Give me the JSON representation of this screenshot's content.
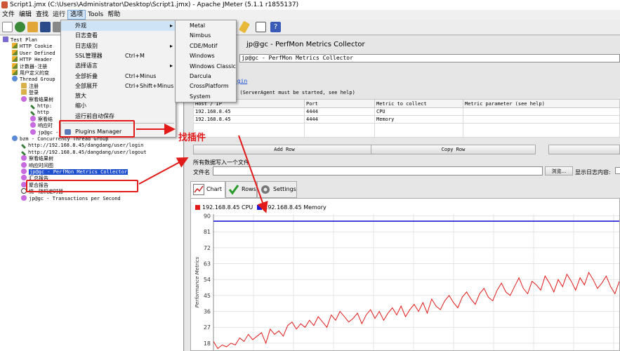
{
  "window": {
    "title": "Script1.jmx (C:\\Users\\Administrator\\Desktop\\Script1.jmx) - Apache JMeter (5.1.1 r1855137)"
  },
  "menubar": [
    "文件",
    "编辑",
    "查找",
    "运行",
    "选项",
    "Tools",
    "帮助"
  ],
  "options_menu": {
    "items": [
      {
        "label": "外观",
        "submenu": true
      },
      {
        "label": "日志查看"
      },
      {
        "label": "日志级别",
        "submenu": true
      },
      {
        "label": "SSL管理器",
        "shortcut": "Ctrl+M"
      },
      {
        "label": "选择语言",
        "submenu": true
      },
      {
        "label": "全部折叠",
        "shortcut": "Ctrl+Minus"
      },
      {
        "label": "全部展开",
        "shortcut": "Ctrl+Shift+Minus"
      },
      {
        "label": "放大"
      },
      {
        "label": "缩小"
      },
      {
        "label": "运行前自动保存"
      },
      {
        "label": "Plugins Manager"
      }
    ]
  },
  "laf_menu": [
    "Metal",
    "Nimbus",
    "CDE/Motif",
    "Windows",
    "Windows Classic",
    "Darcula",
    "CrossPlatform",
    "System"
  ],
  "annotation": {
    "text": "找插件",
    "color": "#e21a1a"
  },
  "tree": [
    {
      "label": "Test Plan",
      "icon": "test",
      "indent": 0
    },
    {
      "label": "HTTP Cookie",
      "icon": "broom",
      "indent": 1
    },
    {
      "label": "User Defined",
      "icon": "broom",
      "indent": 1
    },
    {
      "label": "HTTP Header",
      "icon": "broom",
      "indent": 1
    },
    {
      "label": "计数器-注册",
      "icon": "broom",
      "indent": 1
    },
    {
      "label": "用户定义的变",
      "icon": "broom",
      "indent": 1
    },
    {
      "label": "Thread Group",
      "icon": "thread",
      "indent": 1
    },
    {
      "label": "注册",
      "icon": "folder",
      "indent": 2
    },
    {
      "label": "登录",
      "icon": "folder",
      "indent": 2
    },
    {
      "label": "察看结果树",
      "icon": "listener",
      "indent": 2
    },
    {
      "label": "http:",
      "icon": "pen",
      "indent": 3
    },
    {
      "label": "http",
      "icon": "pen",
      "indent": 3
    },
    {
      "label": "察看结",
      "icon": "listener",
      "indent": 3
    },
    {
      "label": "响应时",
      "icon": "listener",
      "indent": 3
    },
    {
      "label": "jp@gc - PerfMon Metrics Collector",
      "icon": "listener",
      "indent": 3
    },
    {
      "label": "bzm - Concurrency Thread Group",
      "icon": "thread",
      "indent": 1
    },
    {
      "label": "http://192.168.8.45/dangdang/user/login",
      "icon": "pen",
      "indent": 2
    },
    {
      "label": "http://192.168.8.45/dangdang/user/logout",
      "icon": "pen",
      "indent": 2
    },
    {
      "label": "察看结果树",
      "icon": "listener",
      "indent": 2
    },
    {
      "label": "响应时间图",
      "icon": "listener",
      "indent": 2
    },
    {
      "label": "jp@gc - PerfMon Metrics Collector",
      "icon": "listener",
      "indent": 2,
      "selected": true
    },
    {
      "label": "汇总报告",
      "icon": "listener",
      "indent": 2
    },
    {
      "label": "聚合报告",
      "icon": "listener",
      "indent": 2
    },
    {
      "label": "统一随机定时器",
      "icon": "timer",
      "indent": 2
    },
    {
      "label": "jp@gc - Transactions per Second",
      "icon": "listener",
      "indent": 2
    }
  ],
  "panel": {
    "title": "jp@gc - PerfMon Metrics Collector",
    "name_value": "jp@gc - PerfMon Metrics Collector",
    "link": "jmeter-plugins.org/wiki/PerfMon/?utm_source=jmeter&utm_medium=helplink&utm_campaign=PerfMon",
    "link_visible": "ugin",
    "servers_label": "r (ServerAgent must be started, see help)",
    "table": {
      "headers": [
        "Host / IP",
        "Port",
        "Metric to collect",
        "Metric parameter (see help)"
      ],
      "rows": [
        [
          "192.168.8.45",
          "4444",
          "CPU",
          ""
        ],
        [
          "192.168.8.45",
          "4444",
          "Memory",
          ""
        ]
      ]
    },
    "buttons": [
      "Add Row",
      "Copy Row"
    ],
    "write_label": "所有数据写入一个文件",
    "filename_label": "文件名",
    "browse_label": "浏览...",
    "log_label": "显示日志内容:",
    "tabs": [
      "Chart",
      "Rows",
      "Settings"
    ]
  },
  "chart_data": {
    "type": "line",
    "ylabel": "Performance Metrics",
    "ylim": [
      14,
      91
    ],
    "yticks": [
      90,
      81,
      72,
      63,
      54,
      45,
      36,
      27,
      18
    ],
    "series": [
      {
        "name": "192.168.8.45 CPU",
        "color": "#e21a1a",
        "values": [
          19,
          15,
          17,
          16,
          18,
          17,
          21,
          19,
          23,
          20,
          22,
          24,
          18,
          26,
          23,
          25,
          22,
          28,
          30,
          26,
          29,
          27,
          31,
          28,
          33,
          30,
          27,
          34,
          31,
          36,
          33,
          30,
          32,
          35,
          29,
          34,
          37,
          32,
          36,
          31,
          35,
          38,
          34,
          39,
          33,
          37,
          40,
          36,
          41,
          35,
          43,
          39,
          37,
          42,
          45,
          41,
          38,
          44,
          47,
          43,
          40,
          46,
          49,
          44,
          42,
          48,
          52,
          47,
          45,
          50,
          55,
          49,
          46,
          53,
          51,
          48,
          56,
          52,
          47,
          54,
          50,
          57,
          53,
          48,
          55,
          51,
          58,
          54,
          49,
          52,
          56,
          50,
          46,
          53
        ]
      },
      {
        "name": "192.168.8.45 Memory",
        "color": "#1a1ad6",
        "values": [
          87,
          87,
          87,
          87,
          87,
          87,
          87,
          87,
          87,
          87,
          87,
          87,
          87,
          87,
          87,
          87,
          87,
          87,
          87,
          87,
          87,
          87,
          87,
          87,
          87,
          87,
          87,
          87,
          87,
          87,
          87,
          87,
          87,
          87,
          87,
          87,
          87,
          87,
          87,
          87,
          87,
          87,
          87,
          87,
          87,
          87,
          87,
          87,
          87,
          87,
          87,
          87,
          87,
          87,
          87,
          87,
          87,
          87,
          87,
          87,
          87,
          87,
          87,
          87,
          87,
          87,
          87,
          87,
          87,
          87,
          87,
          87,
          87,
          87,
          87,
          87,
          87,
          87,
          87,
          87,
          87,
          87,
          87,
          87,
          87,
          87,
          87,
          87,
          87,
          87,
          87,
          87,
          87,
          87
        ]
      }
    ]
  }
}
